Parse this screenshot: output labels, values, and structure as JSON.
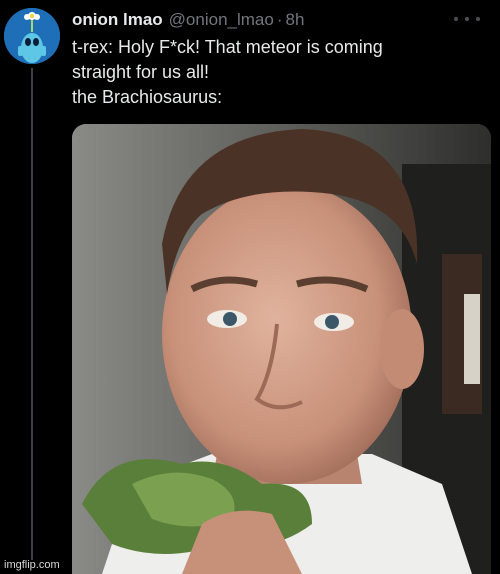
{
  "tweet": {
    "display_name": "onion lmao",
    "handle": "@onion_lmao",
    "separator": "·",
    "timestamp": "8h",
    "text_lines": [
      "t-rex: Holy F*ck! That meteor is coming",
      "straight for us all!",
      "the Brachiosaurus:"
    ]
  },
  "icons": {
    "avatar": "avatar-character-icon",
    "more": "more-options-icon"
  },
  "colors": {
    "background": "#000000",
    "primary_text": "#e7e9ea",
    "secondary_text": "#71767b",
    "avatar_bg": "#1f6fb8"
  },
  "watermark": "imgflip.com"
}
